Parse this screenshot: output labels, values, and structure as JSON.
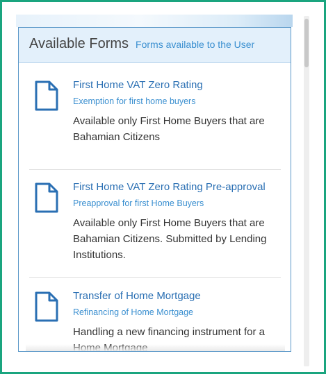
{
  "panel": {
    "title": "Available Forms",
    "subtitle": "Forms available to the User"
  },
  "forms": [
    {
      "title": "First Home VAT Zero Rating",
      "subtitle": "Exemption for first home buyers",
      "description": "Available only First Home Buyers that are Bahamian Citizens",
      "icon": "document-icon"
    },
    {
      "title": "First Home VAT Zero Rating Pre-approval",
      "subtitle": "Preapproval for first Home Buyers",
      "description": "Available only First Home Buyers that are Bahamian Citizens. Submitted by Lending Institutions.",
      "icon": "document-icon"
    },
    {
      "title": "Transfer of Home Mortgage",
      "subtitle": "Refinancing of Home Mortgage",
      "description": "Handling a new financing instrument for a Home Mortgage",
      "icon": "document-icon"
    }
  ],
  "colors": {
    "frame_border": "#1aa57f",
    "panel_border": "#5a97c8",
    "header_bg": "#e3f0fb",
    "link": "#2a6fb3",
    "subtitle": "#3a8fd0"
  }
}
